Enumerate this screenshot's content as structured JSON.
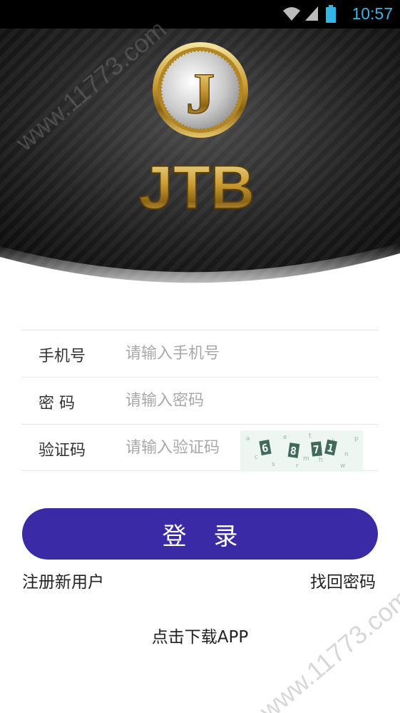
{
  "status_bar": {
    "time": "10:57"
  },
  "brand": {
    "logo_letter": "J",
    "logo_text": "JTB"
  },
  "watermark": {
    "text": "www.11773.com"
  },
  "form": {
    "phone": {
      "label": "手机号",
      "placeholder": "请输入手机号"
    },
    "password": {
      "label": "密 码",
      "placeholder": "请输入密码"
    },
    "captcha": {
      "label": "验证码",
      "placeholder": "请输入验证码",
      "code": "6 8 7 1"
    }
  },
  "actions": {
    "login_label": "登录",
    "register_label": "注册新用户",
    "forgot_label": "找回密码",
    "download_label": "点击下载APP"
  }
}
